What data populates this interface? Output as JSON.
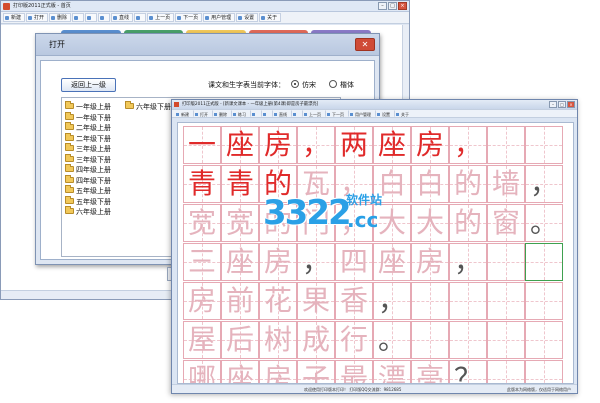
{
  "back_window": {
    "title": "打印版2011正式版 - 首页",
    "toolbar": [
      "新建",
      "打开",
      "删除",
      "",
      "",
      "",
      "直线",
      "",
      "上一页",
      "下一页",
      "用户管理",
      "设置",
      "关于"
    ],
    "status": "欢迎使用打印版本",
    "deco_colors": [
      "#5a8fd0",
      "#4aa06a",
      "#f1c85a",
      "#e06a5a",
      "#8a7bc8"
    ]
  },
  "dialog": {
    "title": "打开",
    "close_glyph": "✕",
    "back_button": "返回上一级",
    "font_label": "课文和生字表当前字体：",
    "font_options": [
      {
        "label": "仿宋",
        "selected": true
      },
      {
        "label": "楷体",
        "selected": false
      }
    ],
    "folders_col1": [
      "一年级上册",
      "一年级下册",
      "二年级上册",
      "二年级下册",
      "三年级上册",
      "三年级下册",
      "四年级上册",
      "四年级下册",
      "五年级上册",
      "五年级下册",
      "六年级上册"
    ],
    "folders_col2": [
      "六年级下册"
    ]
  },
  "front_window": {
    "title": "打印版2011正式版 - [新课文课本 - 一年级上册(第4课)即是房子最漂亮]",
    "toolbar": [
      "新建",
      "打开",
      "删除",
      "练习",
      "",
      "",
      "直线",
      "",
      "上一页",
      "下一页",
      "用户管理",
      "设置",
      "关于"
    ],
    "status_left": "欢迎使用打印版本打印！ 打印版QQ交流群：9812685",
    "status_right": "此版本为网络版，仅适用于网络用户",
    "rows": [
      {
        "chars": [
          "一",
          "座",
          "房",
          "，",
          "两",
          "座",
          "房",
          "，"
        ],
        "styles": [
          "red",
          "red",
          "red",
          "red",
          "red",
          "red",
          "red",
          "red"
        ]
      },
      {
        "chars": [
          "青",
          "青",
          "的",
          "瓦",
          "，",
          "白",
          "白",
          "的",
          "墙",
          "，"
        ],
        "styles": [
          "red",
          "red",
          "red",
          "pale",
          "pale",
          "pale",
          "pale",
          "pale",
          "pale",
          "gray"
        ]
      },
      {
        "chars": [
          "宽",
          "宽",
          "的",
          "门",
          "，",
          "大",
          "大",
          "的",
          "窗",
          "。"
        ],
        "styles": [
          "pale",
          "pale",
          "pale",
          "pale",
          "pale",
          "pale",
          "pale",
          "pale",
          "pale",
          "gray"
        ]
      },
      {
        "chars": [
          "三",
          "座",
          "房",
          "，",
          "四",
          "座",
          "房",
          "，",
          "",
          ""
        ],
        "styles": [
          "pale",
          "pale",
          "pale",
          "gray",
          "pale",
          "pale",
          "pale",
          "gray",
          "pale",
          "pale"
        ]
      },
      {
        "chars": [
          "房",
          "前",
          "花",
          "果",
          "香",
          "，"
        ],
        "styles": [
          "pale",
          "pale",
          "pale",
          "pale",
          "pale",
          "gray"
        ]
      },
      {
        "chars": [
          "屋",
          "后",
          "树",
          "成",
          "行",
          "。"
        ],
        "styles": [
          "pale",
          "pale",
          "pale",
          "pale",
          "pale",
          "gray"
        ]
      },
      {
        "chars": [
          "哪",
          "座",
          "房",
          "子",
          "最",
          "漂",
          "亮",
          "？"
        ],
        "styles": [
          "pale",
          "pale",
          "pale",
          "pale",
          "pale",
          "pale",
          "pale",
          "gray"
        ]
      }
    ]
  },
  "watermark": {
    "number": "3322",
    "site": "软件站",
    "domain": ".cc"
  }
}
